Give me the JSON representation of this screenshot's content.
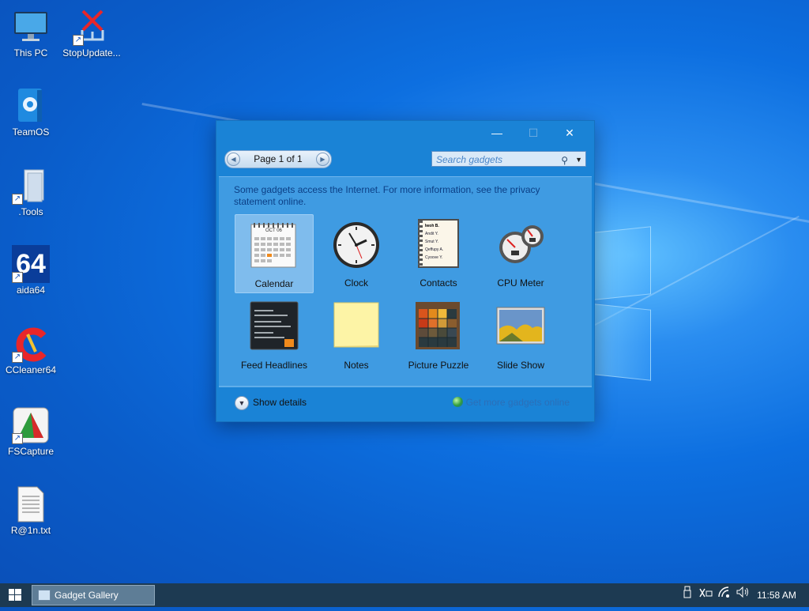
{
  "desktop": {
    "icons": [
      {
        "label": "This PC",
        "icon": "computer-icon"
      },
      {
        "label": "StopUpdate...",
        "icon": "stop-update-icon"
      },
      {
        "label": "TeamOS",
        "icon": "gear-book-icon"
      },
      {
        "label": ".Tools",
        "icon": "folder-icon"
      },
      {
        "label": "aida64",
        "icon": "aida64-icon",
        "badge": "64"
      },
      {
        "label": "CCleaner64",
        "icon": "ccleaner-icon"
      },
      {
        "label": "FSCapture",
        "icon": "fscapture-icon"
      },
      {
        "label": "R@1n.txt",
        "icon": "text-file-icon"
      }
    ]
  },
  "gadget_window": {
    "title_controls": {
      "minimize": "—",
      "maximize": "☐",
      "close": "✕"
    },
    "pager": {
      "text": "Page 1 of 1",
      "prev": "◀",
      "next": "▶"
    },
    "search": {
      "placeholder": "Search gadgets"
    },
    "notice": "Some gadgets access the Internet.  For more information, see the privacy statement online.",
    "gadgets": [
      {
        "label": "Calendar",
        "selected": true
      },
      {
        "label": "Clock",
        "selected": false
      },
      {
        "label": "Contacts",
        "selected": false
      },
      {
        "label": "CPU Meter",
        "selected": false
      },
      {
        "label": "Feed Headlines",
        "selected": false
      },
      {
        "label": "Notes",
        "selected": false
      },
      {
        "label": "Picture Puzzle",
        "selected": false
      },
      {
        "label": "Slide Show",
        "selected": false
      }
    ],
    "calendar_month": "OCT 06",
    "contacts_names": [
      "Iwoh B.",
      "Andit Y.",
      "Smut Y.",
      "Qeffupy A.",
      "Cyoove Y."
    ],
    "show_details": "Show details",
    "get_more": "Get more gadgets online"
  },
  "taskbar": {
    "task_label": "Gadget Gallery",
    "clock": "11:58 AM"
  },
  "colors": {
    "window": "#1a83d6",
    "panel": "#3f9be2",
    "taskbar": "#1d3a52",
    "desktop": "#0d6fe0"
  }
}
